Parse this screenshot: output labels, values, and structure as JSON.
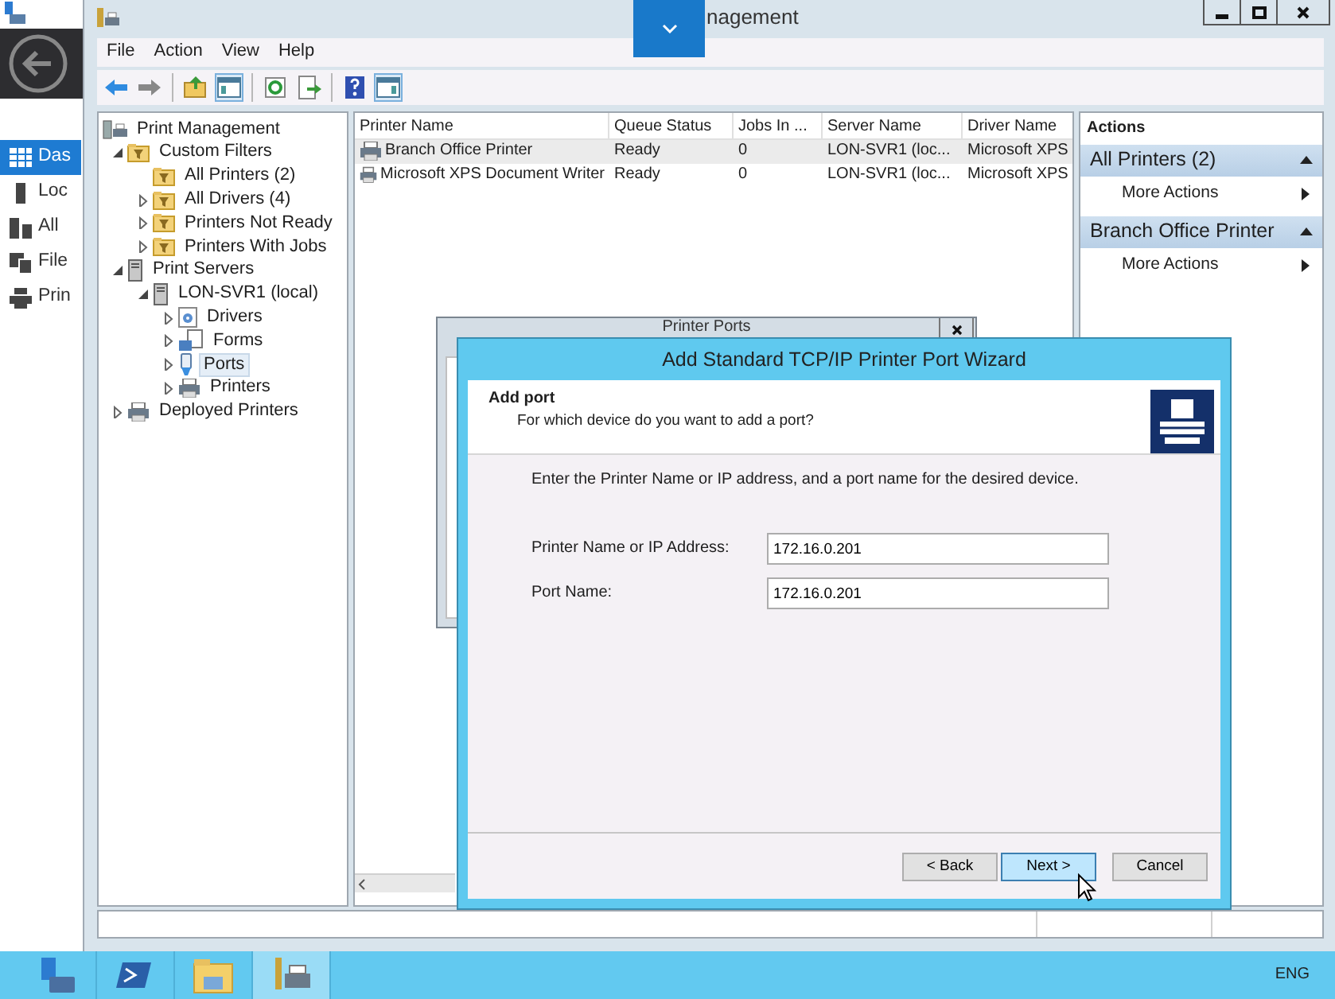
{
  "server_manager": {
    "nav_items": [
      {
        "label": "Das",
        "kind": "dashboard",
        "selected": true
      },
      {
        "label": "Loc",
        "kind": "local",
        "selected": false
      },
      {
        "label": "All",
        "kind": "servers",
        "selected": false
      },
      {
        "label": "File",
        "kind": "file",
        "selected": false
      },
      {
        "label": "Prin",
        "kind": "print",
        "selected": false
      }
    ]
  },
  "window": {
    "title": "nagement",
    "menu": [
      "File",
      "Action",
      "View",
      "Help"
    ],
    "toolbar": [
      {
        "kind": "back",
        "pressed": false
      },
      {
        "kind": "forward",
        "pressed": false
      },
      {
        "kind": "sep"
      },
      {
        "kind": "up",
        "pressed": false
      },
      {
        "kind": "tree",
        "pressed": true
      },
      {
        "kind": "sep"
      },
      {
        "kind": "refresh",
        "pressed": false
      },
      {
        "kind": "export",
        "pressed": false
      },
      {
        "kind": "sep"
      },
      {
        "kind": "help",
        "pressed": false
      },
      {
        "kind": "actionpane",
        "pressed": true
      }
    ]
  },
  "tree": [
    {
      "label": "Print Management",
      "kind": "root",
      "selected": false,
      "children": [
        {
          "label": "Custom Filters",
          "kind": "filter",
          "expanded": true,
          "selected": false,
          "children": [
            {
              "label": "All Printers (2)",
              "kind": "filter",
              "selected": false
            },
            {
              "label": "All Drivers (4)",
              "kind": "filter",
              "expanded": false,
              "selected": false
            },
            {
              "label": "Printers Not Ready",
              "kind": "filter",
              "expanded": false,
              "selected": false
            },
            {
              "label": "Printers With Jobs",
              "kind": "filter",
              "expanded": false,
              "selected": false
            }
          ]
        },
        {
          "label": "Print Servers",
          "kind": "server",
          "expanded": true,
          "selected": false,
          "children": [
            {
              "label": "LON-SVR1 (local)",
              "kind": "server",
              "expanded": true,
              "selected": false,
              "children": [
                {
                  "label": "Drivers",
                  "kind": "drivers",
                  "expanded": false,
                  "selected": false
                },
                {
                  "label": "Forms",
                  "kind": "forms",
                  "expanded": false,
                  "selected": false
                },
                {
                  "label": "Ports",
                  "kind": "ports",
                  "expanded": false,
                  "selected": true
                },
                {
                  "label": "Printers",
                  "kind": "printer",
                  "expanded": false,
                  "selected": false
                }
              ]
            }
          ]
        },
        {
          "label": "Deployed Printers",
          "kind": "printer",
          "expanded": false,
          "selected": false
        }
      ]
    }
  ],
  "table": {
    "columns": [
      "Printer Name",
      "Queue Status",
      "Jobs In ...",
      "Server Name",
      "Driver Name"
    ],
    "rows": [
      {
        "selected": true,
        "cells": [
          "Branch Office Printer",
          "Ready",
          "0",
          "LON-SVR1 (loc...",
          "Microsoft XPS"
        ]
      },
      {
        "selected": false,
        "cells": [
          "Microsoft XPS Document Writer",
          "Ready",
          "0",
          "LON-SVR1 (loc...",
          "Microsoft XPS"
        ]
      }
    ]
  },
  "actions": {
    "title": "Actions",
    "sections": [
      {
        "heading": "All Printers (2)",
        "items": [
          "More Actions"
        ]
      },
      {
        "heading": "Branch Office Printer",
        "items": [
          "More Actions"
        ]
      }
    ]
  },
  "printer_ports_dialog": {
    "title": "Printer Ports"
  },
  "wizard": {
    "title": "Add Standard TCP/IP Printer Port Wizard",
    "heading": "Add port",
    "subheading": "For which device do you want to add a port?",
    "instruction": "Enter the Printer Name or IP address, and a port name for the desired device.",
    "fields": [
      {
        "label": "Printer Name or IP Address:",
        "value": "172.16.0.201"
      },
      {
        "label": "Port Name:",
        "value": "172.16.0.201"
      }
    ],
    "buttons": [
      {
        "label": "< Back",
        "default": false
      },
      {
        "label": "Next >",
        "default": true
      },
      {
        "label": "Cancel",
        "default": false
      }
    ]
  },
  "taskbar": {
    "apps": [
      {
        "kind": "server-manager",
        "active": false
      },
      {
        "kind": "powershell",
        "active": false
      },
      {
        "kind": "explorer",
        "active": false
      },
      {
        "kind": "print-management",
        "active": true
      }
    ],
    "language": "ENG"
  }
}
